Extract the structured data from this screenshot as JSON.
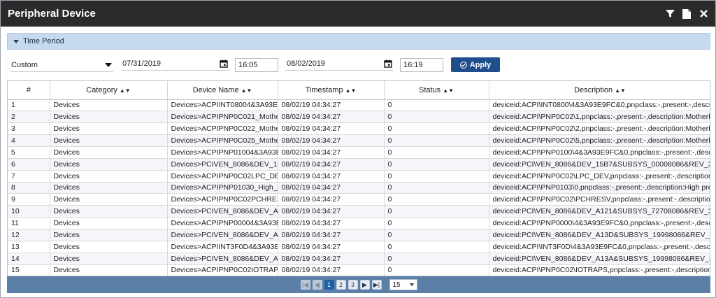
{
  "window": {
    "title": "Peripheral Device",
    "icons": [
      "filter-icon",
      "export-file-icon",
      "close-icon"
    ]
  },
  "time_period": {
    "label": "Time Period",
    "range_value": "Custom",
    "start_date": "07/31/2019",
    "start_time": "16:05",
    "end_date": "08/02/2019",
    "end_time": "16:19",
    "apply_label": "Apply"
  },
  "table": {
    "columns": [
      "#",
      "Category",
      "Device Name",
      "Timestamp",
      "Status",
      "Description"
    ],
    "rows": [
      [
        "1",
        "Devices",
        "Devices>ACPIINT08004&3A93E9",
        "08/02/19 04:34:27",
        "0",
        "deviceid:ACPI\\INT0800\\4&3A93E9FC&0,pnpclass:-,present:-,descript"
      ],
      [
        "2",
        "Devices",
        "Devices>ACPIPNP0C021_Mother",
        "08/02/19 04:34:27",
        "0",
        "deviceid:ACPI\\PNP0C02\\1,pnpclass:-,present:-,description:Motherbo"
      ],
      [
        "3",
        "Devices",
        "Devices>ACPIPNP0C022_Mother",
        "08/02/19 04:34:27",
        "0",
        "deviceid:ACPI\\PNP0C02\\2,pnpclass:-,present:-,description:Motherbo"
      ],
      [
        "4",
        "Devices",
        "Devices>ACPIPNP0C025_Mother",
        "08/02/19 04:34:27",
        "0",
        "deviceid:ACPI\\PNP0C02\\5,pnpclass:-,present:-,description:Motherbo"
      ],
      [
        "5",
        "Devices",
        "Devices>ACPIPNP01004&3A93E9",
        "08/02/19 04:34:27",
        "0",
        "deviceid:ACPI\\PNP0100\\4&3A93E9FC&0,pnpclass:-,present:-,descrip"
      ],
      [
        "6",
        "Devices",
        "Devices>PCIVEN_8086&DEV_15B",
        "08/02/19 04:34:27",
        "0",
        "deviceid:PCI\\VEN_8086&DEV_15B7&SUBSYS_00008086&REV_31\\3"
      ],
      [
        "7",
        "Devices",
        "Devices>ACPIPNP0C02LPC_DEV",
        "08/02/19 04:34:27",
        "0",
        "deviceid:ACPI\\PNP0C02\\LPC_DEV,pnpclass:-,present:-,description:M"
      ],
      [
        "8",
        "Devices",
        "Devices>ACPIPNP01030_High_pr",
        "08/02/19 04:34:27",
        "0",
        "deviceid:ACPI\\PNP0103\\0,pnpclass:-,present:-,description:High prec"
      ],
      [
        "9",
        "Devices",
        "Devices>ACPIPNP0C02PCHRESV",
        "08/02/19 04:34:27",
        "0",
        "deviceid:ACPI\\PNP0C02\\PCHRESV,pnpclass:-,present:-,description:M"
      ],
      [
        "10",
        "Devices",
        "Devices>PCIVEN_8086&DEV_A12",
        "08/02/19 04:34:27",
        "0",
        "deviceid:PCI\\VEN_8086&DEV_A121&SUBSYS_72708086&REV_31\\3"
      ],
      [
        "11",
        "Devices",
        "Devices>ACPIPNP00004&3A93E9",
        "08/02/19 04:34:27",
        "0",
        "deviceid:ACPI\\PNP0000\\4&3A93E9FC&0,pnpclass:-,present:-,descrip"
      ],
      [
        "12",
        "Devices",
        "Devices>PCIVEN_8086&DEV_A13",
        "08/02/19 04:34:27",
        "0",
        "deviceid:PCI\\VEN_8086&DEV_A13D&SUBSYS_19998086&REV_31\\3"
      ],
      [
        "13",
        "Devices",
        "Devices>ACPIINT3F0D4&3A93E9",
        "08/02/19 04:34:27",
        "0",
        "deviceid:ACPI\\INT3F0D\\4&3A93E9FC&0,pnpclass:-,present:-,descrip"
      ],
      [
        "14",
        "Devices",
        "Devices>PCIVEN_8086&DEV_A13",
        "08/02/19 04:34:27",
        "0",
        "deviceid:PCI\\VEN_8086&DEV_A13A&SUBSYS_19998086&REV_31\\3"
      ],
      [
        "15",
        "Devices",
        "Devices>ACPIPNP0C02IOTRAPS",
        "08/02/19 04:34:27",
        "0",
        "deviceid:ACPI\\PNP0C02\\IOTRAPS,pnpclass:-,present:-,description:M"
      ]
    ]
  },
  "pager": {
    "pages": [
      "1",
      "2",
      "3"
    ],
    "current_page": "1",
    "page_size": "15"
  },
  "colors": {
    "titlebar": "#2b2b2b",
    "section_header": "#c7d9ef",
    "apply_button": "#1f4e8c",
    "pager_bar": "#5b7fa6"
  }
}
